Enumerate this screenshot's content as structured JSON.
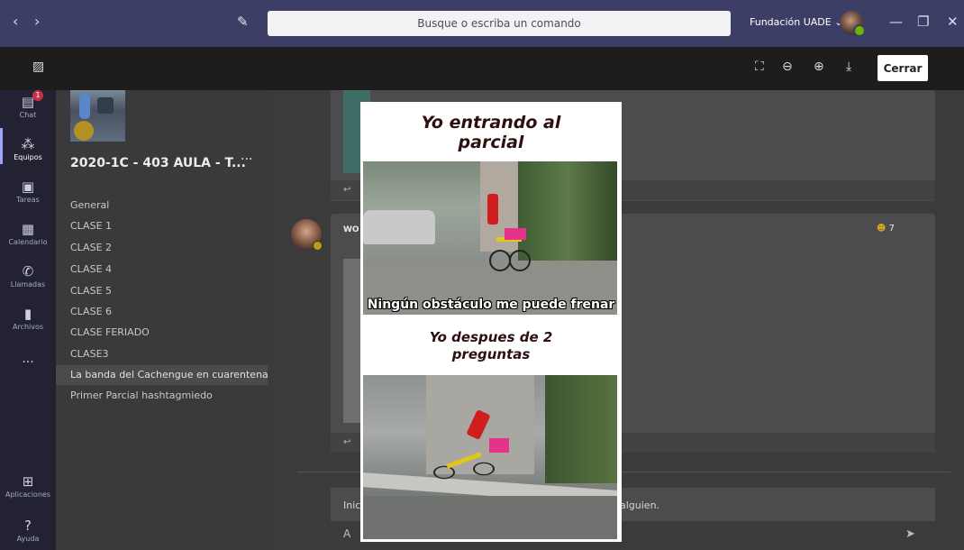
{
  "titlebar": {
    "search_placeholder": "Busque o escriba un comando",
    "org_name": "Fundación UADE",
    "org_chevron": "⌄"
  },
  "viewer": {
    "close_label": "Cerrar"
  },
  "rail": {
    "items": [
      {
        "label": "Chat",
        "icon": "chat-icon",
        "badge": "1"
      },
      {
        "label": "Equipos",
        "icon": "teams-icon"
      },
      {
        "label": "Tareas",
        "icon": "assignments-icon"
      },
      {
        "label": "Calendario",
        "icon": "calendar-icon"
      },
      {
        "label": "Llamadas",
        "icon": "calls-icon"
      },
      {
        "label": "Archivos",
        "icon": "files-icon"
      },
      {
        "label": "...",
        "icon": "more-icon"
      },
      {
        "label": "Aplicaciones",
        "icon": "apps-icon"
      },
      {
        "label": "Ayuda",
        "icon": "help-icon"
      }
    ]
  },
  "team": {
    "name": "2020-1C - 403 AULA - T...",
    "more": "···",
    "channels": [
      "General",
      "CLASE 1",
      "CLASE 2",
      "CLASE 4",
      "CLASE 5",
      "CLASE 6",
      "CLASE FERIADO",
      "CLASE3",
      "La banda del Cachengue en cuarentena",
      "Primer Parcial hashtagmiedo"
    ]
  },
  "conversation": {
    "sender_initials": "WO",
    "reaction_count": "7",
    "compose_left": "Inic",
    "compose_right": "alguien."
  },
  "meme": {
    "caption_top_line1": "Yo entrando al",
    "caption_top_line2": "parcial",
    "subtitle": "Ningún obstáculo me puede frenar",
    "caption_mid_line1": "Yo despues de 2",
    "caption_mid_line2": "preguntas"
  },
  "colors": {
    "titlebar": "#3d3e66",
    "rail": "#222233",
    "accent": "#9ea2ff"
  }
}
